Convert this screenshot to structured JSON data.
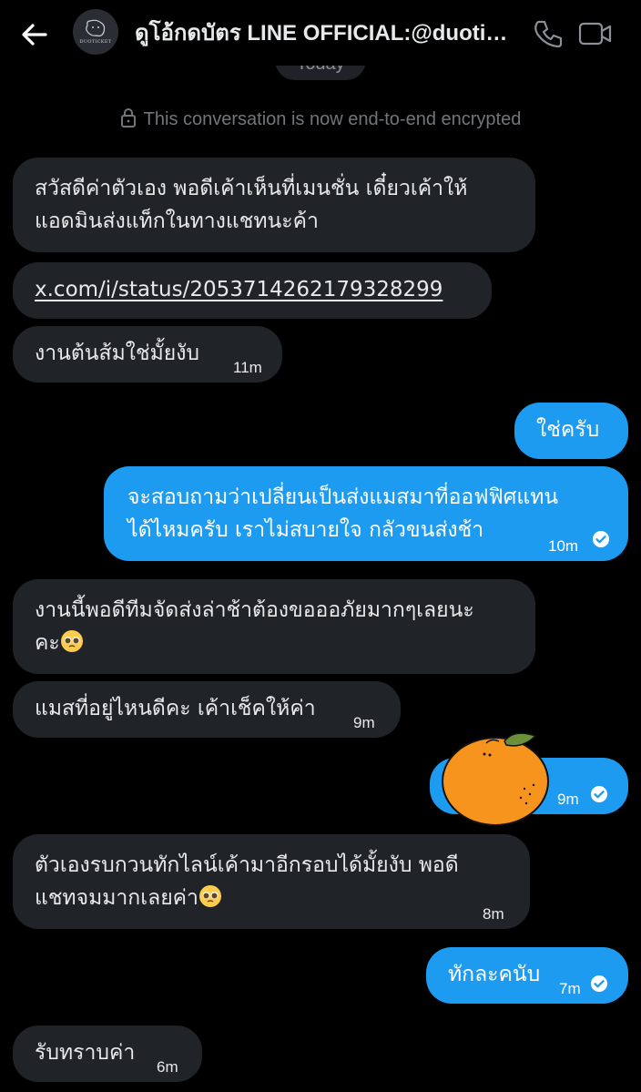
{
  "header": {
    "title": "ดูโอ้กดบัตร LINE OFFICIAL:@duoticket",
    "avatar_text": "DUOTICKET"
  },
  "date_divider": "Today",
  "encryption_notice": "This conversation is now end-to-end encrypted",
  "colors": {
    "background": "#000000",
    "received_bubble": "#202327",
    "sent_bubble": "#1d9bf0",
    "muted_text": "#71767b"
  },
  "messages": [
    {
      "side": "received",
      "text": "สวัสดีค่าตัวเอง พอดีเค้าเห็นที่เมนชั่น เดี๋ยวเค้าให้\nแอดมินส่งแท็กในทางแชทนะค้า"
    },
    {
      "side": "received",
      "text": "x.com/i/status/2053714262179328299",
      "is_link": true
    },
    {
      "side": "received",
      "text": "งานต้นส้มใช่มั้ยงับ",
      "time": "11m"
    },
    {
      "side": "sent",
      "text": "ใช่ครับ"
    },
    {
      "side": "sent",
      "text": "จะสอบถามว่าเปลี่ยนเป็นส่งแมสมาที่ออฟฟิศแทน\nได้ไหมครับ เราไม่สบายใจ กลัวขนส่งช้า",
      "time": "10m",
      "read": true
    },
    {
      "side": "received",
      "text": "งานนี้พอดีทีมจัดส่งล่าช้าต้องขอออภัยมากๆเลยนะ\nคะ",
      "emoji": "pleading-face"
    },
    {
      "side": "received",
      "text": "แมสที่อยู่ไหนดีคะ เค้าเช็คให้ค่า",
      "time": "9m"
    },
    {
      "side": "sent",
      "sticker": "tangerine-sticker",
      "time": "9m",
      "read": true
    },
    {
      "side": "received",
      "text": "ตัวเองรบกวนทักไลน์เค้ามาอีกรอบได้มั้ยงับ พอดี\nแชทจมมากเลยค่า",
      "emoji": "pleading-face",
      "time": "8m"
    },
    {
      "side": "sent",
      "text": "ทักละคนับ",
      "time": "7m",
      "read": true
    },
    {
      "side": "received",
      "text": "รับทราบค่า",
      "time": "6m"
    }
  ]
}
